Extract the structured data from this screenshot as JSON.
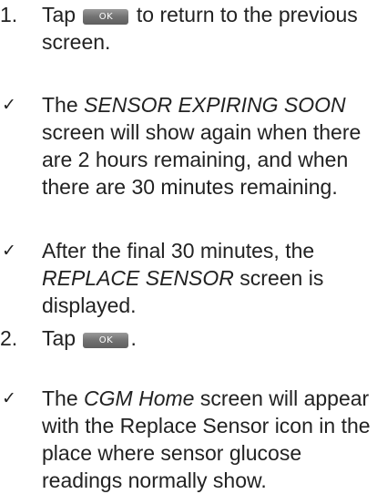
{
  "step1": {
    "number": "1.",
    "text_before": "Tap",
    "button_label": "OK",
    "text_after": "to return to the previous screen."
  },
  "note1": {
    "mark": "✓",
    "text_before": "The",
    "emphasis": "SENSOR EXPIRING SOON",
    "text_after": "screen will show again when there are 2 hours remaining, and when there are 30 minutes remaining."
  },
  "note2": {
    "mark": "✓",
    "text_before": "After the final 30 minutes, the",
    "emphasis": "REPLACE SENSOR",
    "text_after": "screen is displayed."
  },
  "step2": {
    "number": "2.",
    "text_before": "Tap",
    "button_label": "OK",
    "text_after": "."
  },
  "note3": {
    "mark": "✓",
    "text_before": "The",
    "emphasis": "CGM Home",
    "text_after": "screen will appear with the Replace Sensor icon in the place where sensor glucose readings normally show."
  }
}
